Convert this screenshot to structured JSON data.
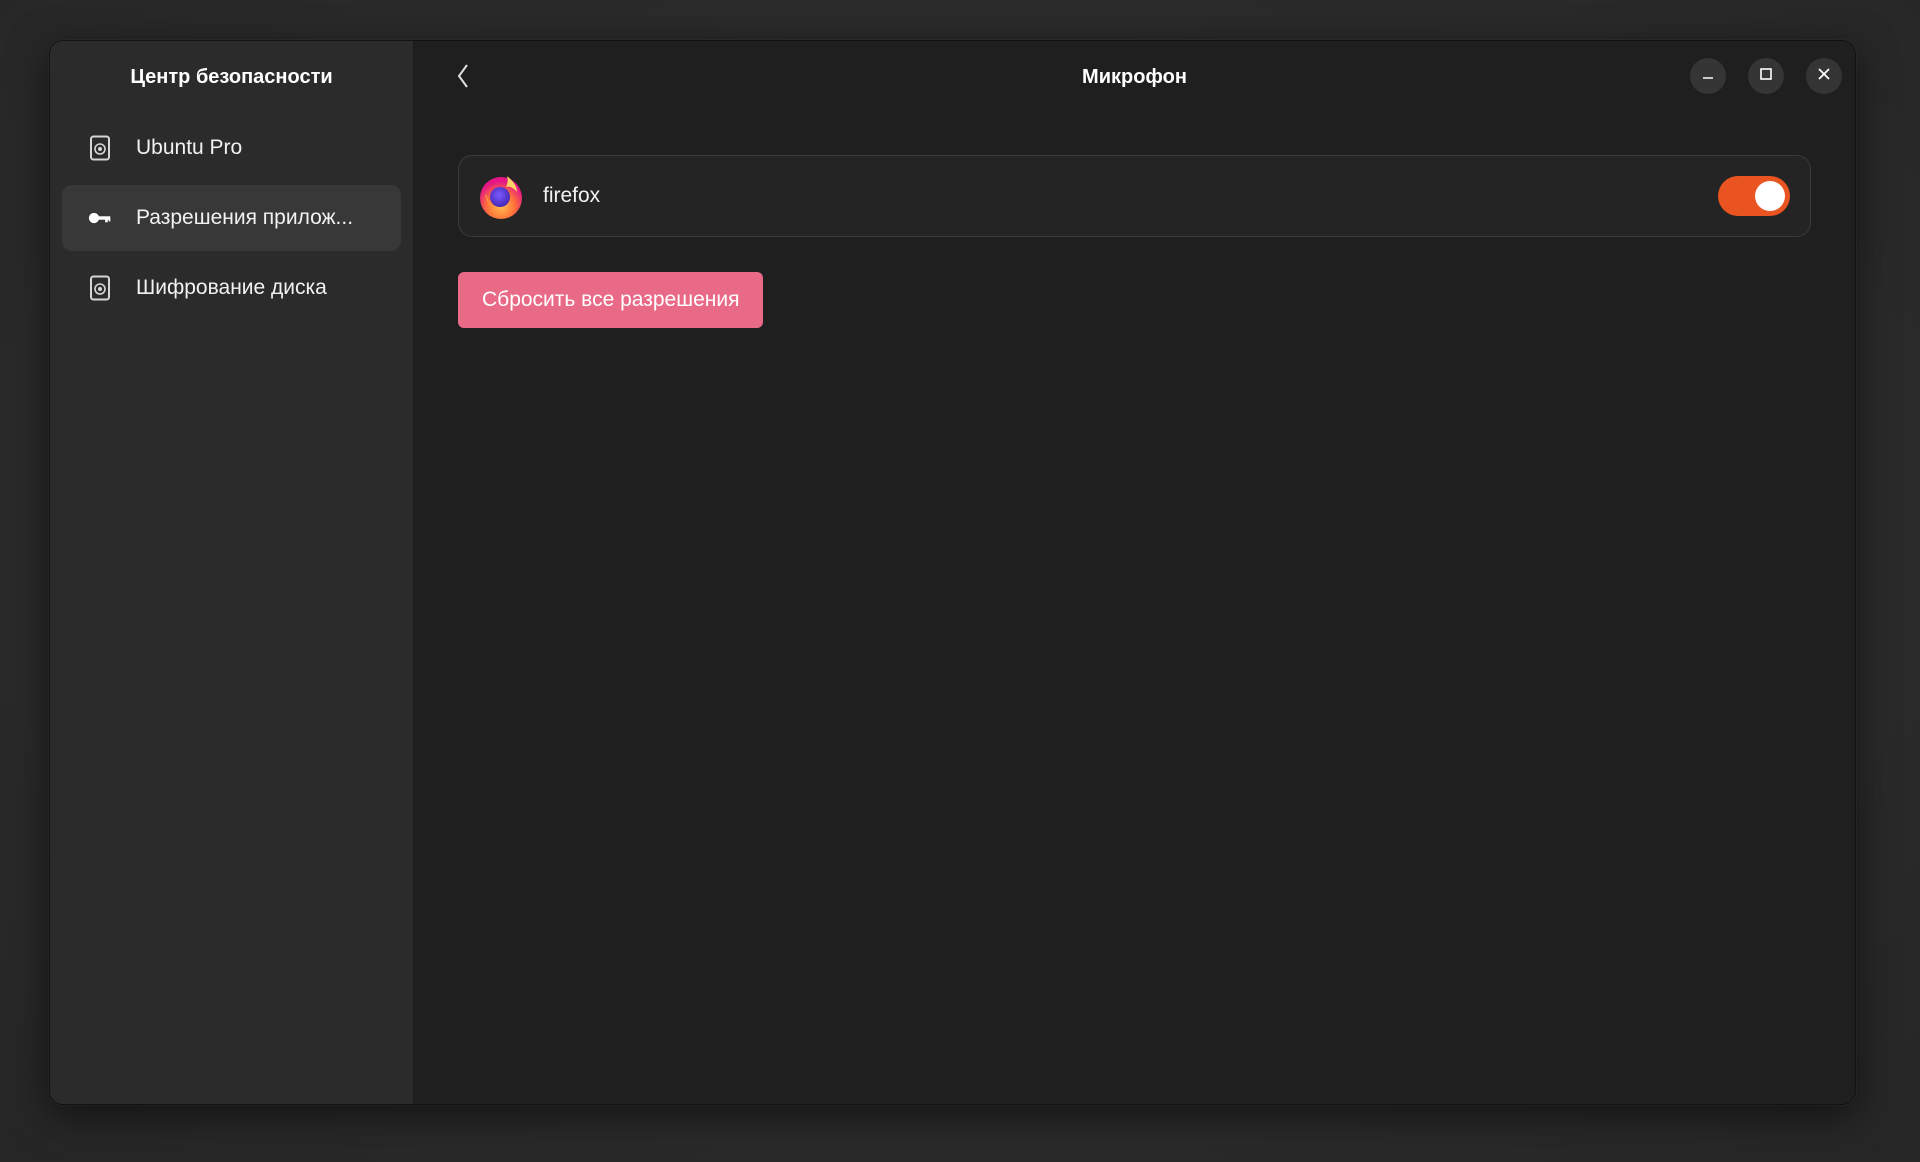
{
  "sidebar": {
    "title": "Центр безопасности",
    "items": [
      {
        "label": "Ubuntu Pro",
        "icon": "shield-document-icon",
        "selected": false
      },
      {
        "label": "Разрешения прилож...",
        "icon": "key-icon",
        "selected": true
      },
      {
        "label": "Шифрование диска",
        "icon": "shield-document-icon",
        "selected": false
      }
    ]
  },
  "header": {
    "title": "Микрофон",
    "back_icon": "chevron-left-icon",
    "controls": {
      "minimize_icon": "minimize-icon",
      "maximize_icon": "maximize-icon",
      "close_icon": "close-icon"
    }
  },
  "apps": [
    {
      "name": "firefox",
      "icon": "firefox-icon",
      "enabled": true
    }
  ],
  "reset_button": {
    "label": "Сбросить все разрешения"
  },
  "colors": {
    "accent": "#e95420",
    "destructive": "#e96a86",
    "window_bg": "#1f1f1f",
    "sidebar_bg": "#2b2b2b",
    "selected_item_bg": "#383838"
  }
}
